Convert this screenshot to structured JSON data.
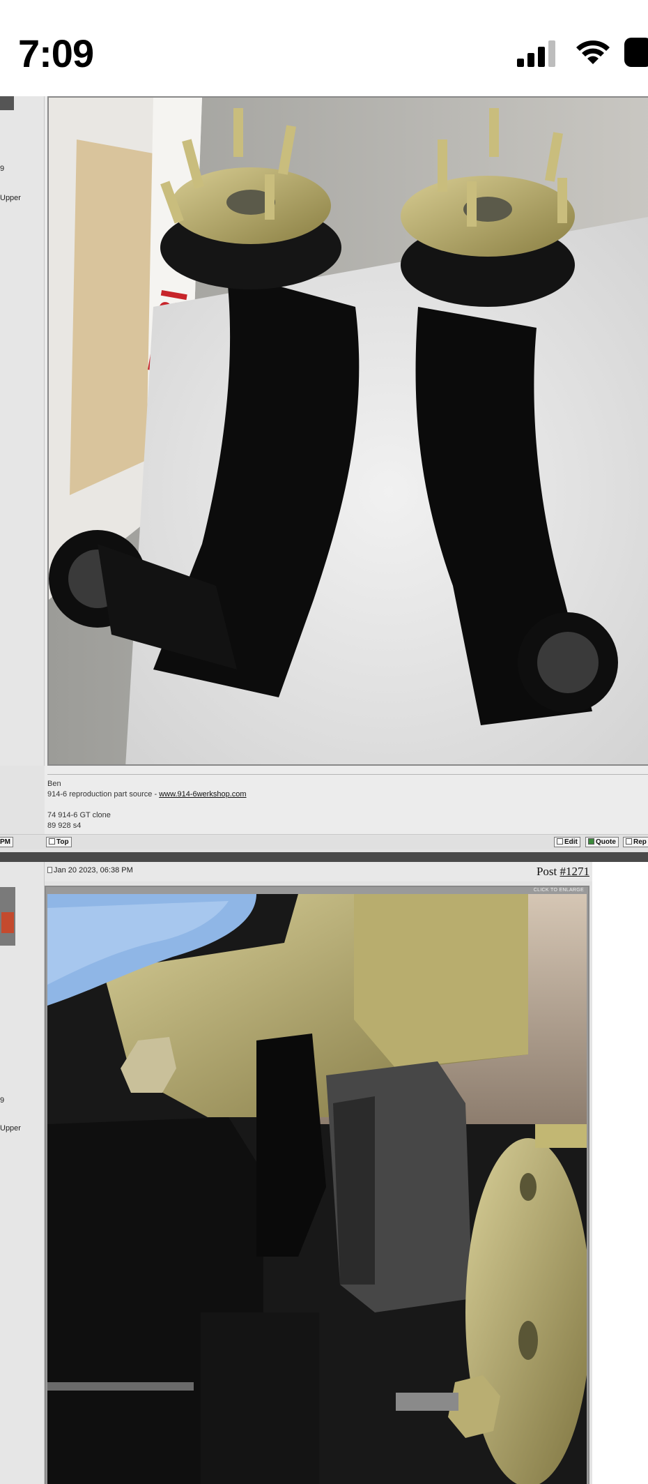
{
  "status_bar": {
    "time": "7:09"
  },
  "post1": {
    "left_col_text": [
      "9",
      "Upper"
    ],
    "signature": {
      "name": "Ben",
      "line1_prefix": "914-6 reproduction part source - ",
      "link_text": "www.914-6werkshop.com",
      "car1": "74 914-6 GT clone",
      "car2": "89 928 s4"
    },
    "left_time_fragment": "PM",
    "buttons": {
      "top": "Top",
      "edit": "Edit",
      "quote": "Quote",
      "reply": "Rep"
    }
  },
  "post2": {
    "left_col_text": [
      "9",
      "Upper"
    ],
    "date": "Jan 20 2023, 06:38 PM",
    "post_label": "Post ",
    "post_number": "#1271",
    "enlarge_label": "CLICK TO ENLARGE"
  }
}
